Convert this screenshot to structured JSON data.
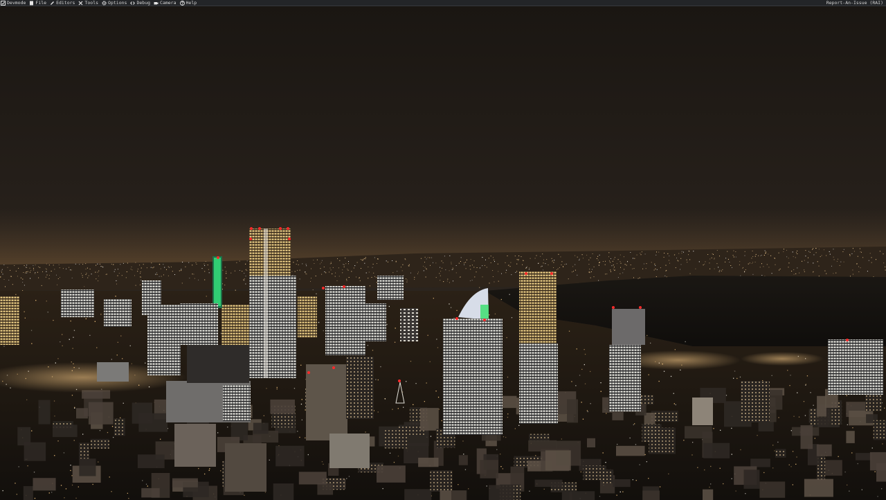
{
  "menu": {
    "items": [
      {
        "label": "Devmode",
        "icon": "devmode-icon"
      },
      {
        "label": "File",
        "icon": "file-icon"
      },
      {
        "label": "Editors",
        "icon": "pencil-icon"
      },
      {
        "label": "Tools",
        "icon": "tools-icon"
      },
      {
        "label": "Options",
        "icon": "gear-icon"
      },
      {
        "label": "Debug",
        "icon": "code-icon"
      },
      {
        "label": "Camera",
        "icon": "camera-icon"
      },
      {
        "label": "Help",
        "icon": "help-icon"
      }
    ],
    "report_issue": "Report-An-Issue (RAI)"
  },
  "colors": {
    "menu_bg": "#232528",
    "sky_top": "#1c1814",
    "sky_horizon": "#3a3128",
    "city_light": "#ffd79a",
    "window_light": "#f3f1e8",
    "aviation_red": "#ff2a2a",
    "tower_green": "#3cff7a"
  }
}
